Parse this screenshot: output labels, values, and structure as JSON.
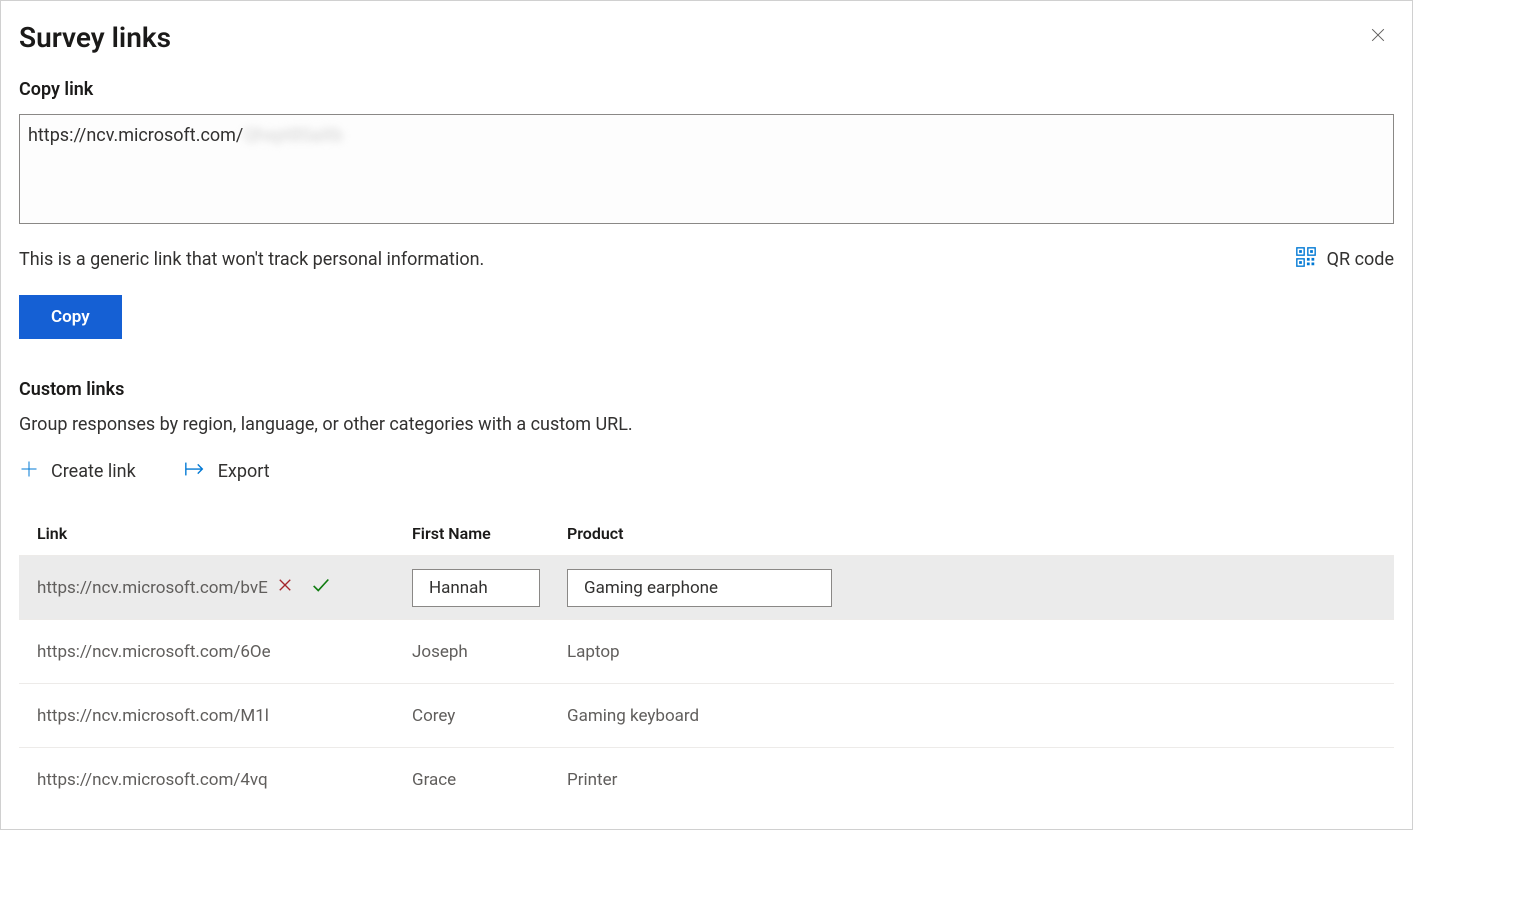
{
  "title": "Survey links",
  "copy_link": {
    "label": "Copy link",
    "url_prefix": "https://ncv.microsoft.com/",
    "url_suffix_obscured": "Qhxpt8SaXb",
    "helper_text": "This is a generic link that won't track personal information.",
    "qr_label": "QR code",
    "copy_button": "Copy"
  },
  "custom_links": {
    "heading": "Custom links",
    "description": "Group responses by region, language, or other categories with a custom URL.",
    "create_label": "Create link",
    "export_label": "Export",
    "columns": {
      "link": "Link",
      "first_name": "First Name",
      "product": "Product"
    },
    "rows": [
      {
        "link": "https://ncv.microsoft.com/bvE",
        "first_name": "Hannah",
        "product": "Gaming earphone",
        "editing": true
      },
      {
        "link": "https://ncv.microsoft.com/6Oe",
        "first_name": "Joseph",
        "product": "Laptop",
        "editing": false
      },
      {
        "link": "https://ncv.microsoft.com/M1l",
        "first_name": "Corey",
        "product": "Gaming keyboard",
        "editing": false
      },
      {
        "link": "https://ncv.microsoft.com/4vq",
        "first_name": "Grace",
        "product": "Printer",
        "editing": false
      }
    ]
  }
}
